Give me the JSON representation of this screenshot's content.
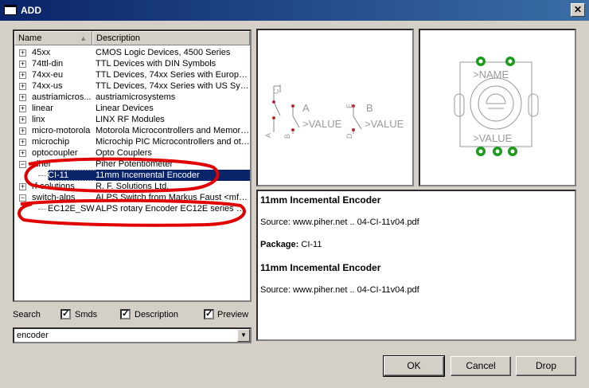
{
  "window": {
    "title": "ADD",
    "close_glyph": "✕"
  },
  "tree": {
    "columns": {
      "name": "Name",
      "description": "Description"
    },
    "rows": [
      {
        "name": "45xx",
        "desc": "CMOS Logic Devices, 4500 Series",
        "exp": "+"
      },
      {
        "name": "74ttl-din",
        "desc": "TTL Devices with DIN Symbols",
        "exp": "+"
      },
      {
        "name": "74xx-eu",
        "desc": "TTL Devices, 74xx Series with Europe...",
        "exp": "+"
      },
      {
        "name": "74xx-us",
        "desc": "TTL Devices, 74xx Series with US Sym...",
        "exp": "+"
      },
      {
        "name": "austriamicros...",
        "desc": "austriamicrosystems",
        "exp": "+"
      },
      {
        "name": "linear",
        "desc": "Linear Devices",
        "exp": "+"
      },
      {
        "name": "linx",
        "desc": "LINX RF Modules",
        "exp": "+"
      },
      {
        "name": "micro-motorola",
        "desc": "Motorola Microcontrollers and Memories",
        "exp": "+"
      },
      {
        "name": "microchip",
        "desc": "Microchip PIC Microcontrollers and oth...",
        "exp": "+"
      },
      {
        "name": "optocoupler",
        "desc": "Opto Couplers",
        "exp": "+"
      },
      {
        "name": "piher",
        "desc": "Piher Potentiometer",
        "exp": "−"
      },
      {
        "name": "CI-11",
        "desc": "11mm Incemental Encoder",
        "child": true,
        "selected": true
      },
      {
        "name": "rf-solutions",
        "desc": "R. F. Solutions Ltd.",
        "exp": "+"
      },
      {
        "name": "switch-alps",
        "desc": "ALPS Switch from Markus Faust <mfa...",
        "exp": "−"
      },
      {
        "name": "EC12E_SW",
        "desc": "ALPS rotary Encoder EC12E series wit...",
        "child": true
      }
    ]
  },
  "options": {
    "search": {
      "label": "Search",
      "checked": true
    },
    "smds": {
      "label": "Smds",
      "checked": true
    },
    "description": {
      "label": "Description",
      "checked": true
    },
    "preview": {
      "label": "Preview",
      "checked": true
    },
    "check_glyph": "✓"
  },
  "search": {
    "value": "encoder",
    "arrow": "▼"
  },
  "symbol_preview": {
    "label_a": "A",
    "label_b": "B",
    "value_text": ">VALUE",
    "pins": [
      "A",
      "B",
      "C",
      "D",
      "E"
    ]
  },
  "package_preview": {
    "name_text": ">NAME",
    "value_text": ">VALUE"
  },
  "info": {
    "heading": "11mm Incemental Encoder",
    "source": "Source: www.piher.net .. 04-CI-11v04.pdf",
    "package_label": "Package:",
    "package_value": "CI-11",
    "heading2": "11mm Incemental Encoder",
    "source2": "Source: www.piher.net .. 04-CI-11v04.pdf"
  },
  "buttons": {
    "ok": "OK",
    "cancel": "Cancel",
    "drop": "Drop"
  },
  "colors": {
    "title_bar": "#0a246a",
    "selection": "#0a246a",
    "annotation": "#e00000",
    "pad": "#1a9b1a"
  }
}
